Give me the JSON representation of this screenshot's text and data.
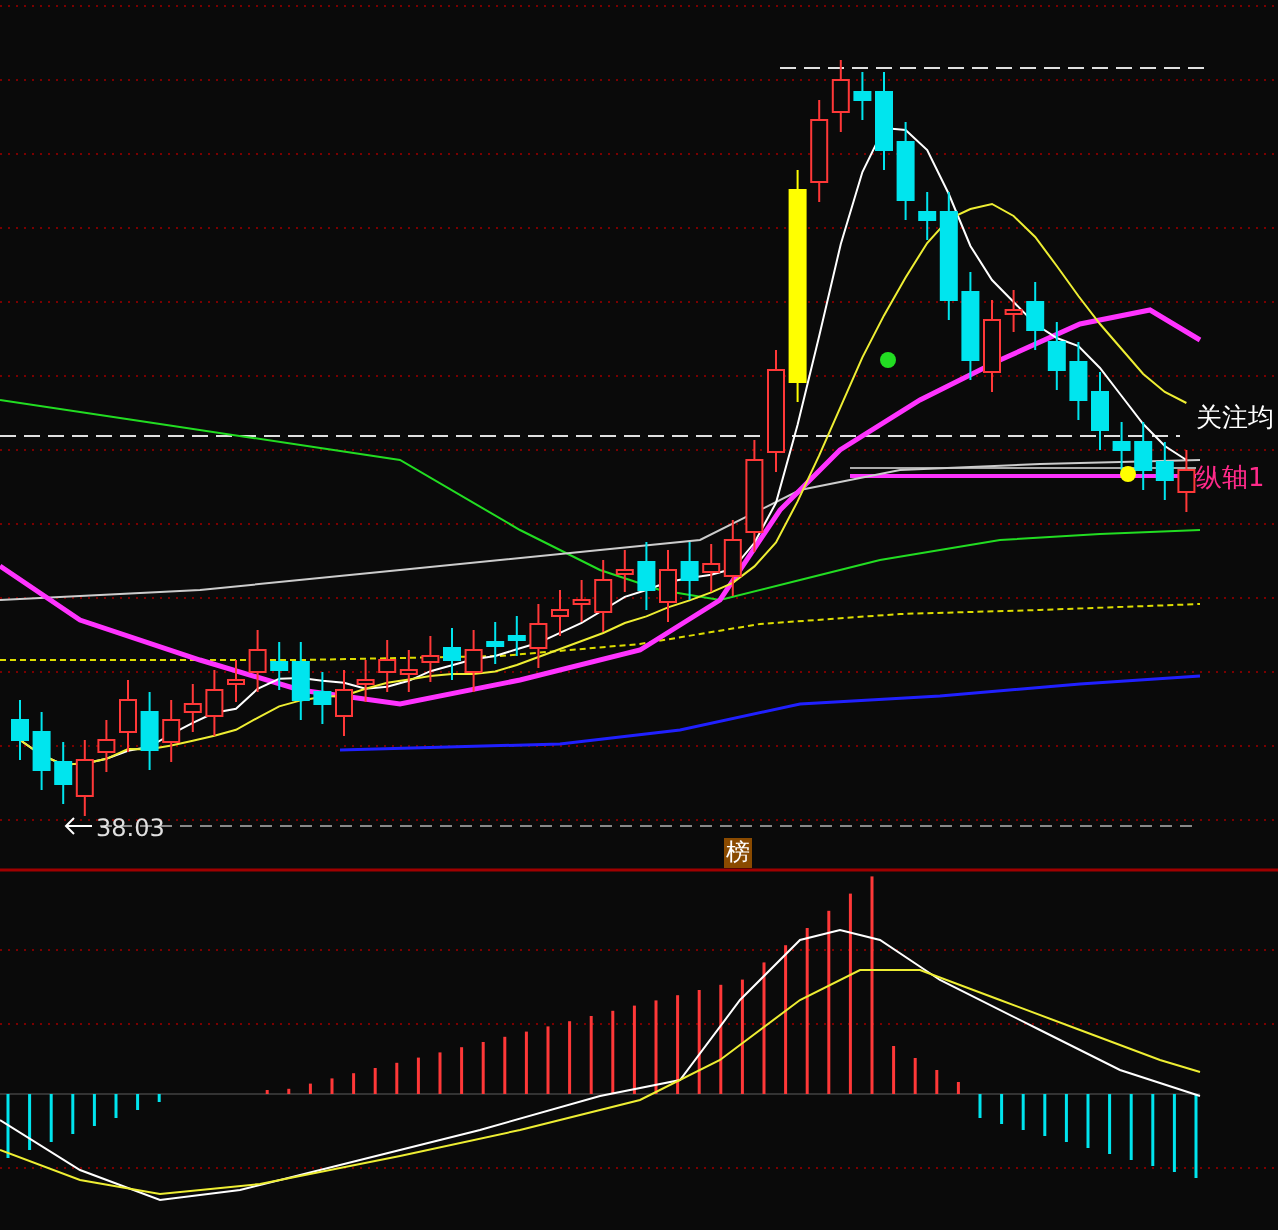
{
  "price_chart": {
    "low_label": "38.03",
    "annotations": [
      {
        "text": "关注均",
        "color": "#ffffff"
      },
      {
        "text": "纵轴1",
        "color": "#ff2a8a"
      }
    ]
  },
  "indicator_panel": {
    "badge": "榜"
  }
}
